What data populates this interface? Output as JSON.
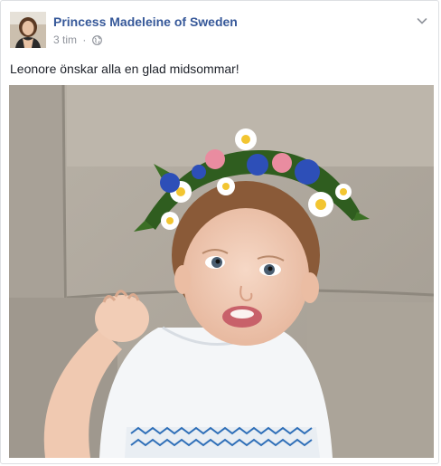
{
  "post": {
    "author": "Princess Madeleine of Sweden",
    "timestamp": "3 tim",
    "separator": "·",
    "privacy_icon": "globe-icon",
    "menu_icon": "chevron-down-icon",
    "text": "Leonore önskar alla en glad midsommar!"
  },
  "colors": {
    "author_link": "#365899",
    "meta_text": "#90949c",
    "body_text": "#1d2129",
    "border": "#dddfe2"
  }
}
